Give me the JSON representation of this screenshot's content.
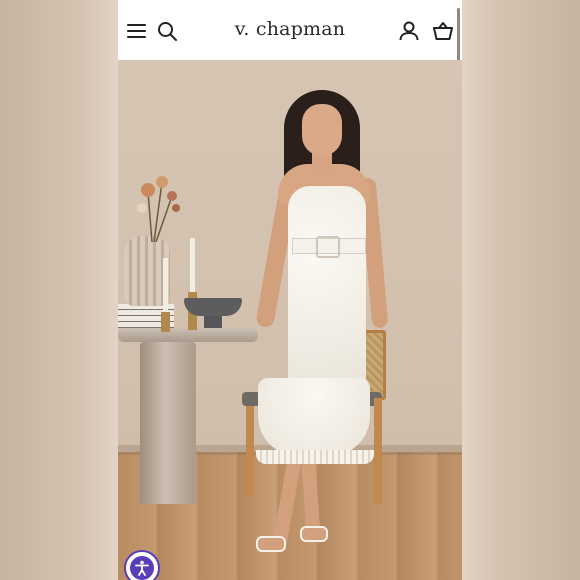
{
  "header": {
    "logo_text": "v. chapman",
    "menu_icon": "hamburger-icon",
    "search_icon": "search-icon",
    "account_icon": "user-icon",
    "cart_icon": "basket-icon"
  },
  "colors": {
    "header_bg": "#ffffff",
    "icon_color": "#222222",
    "accessibility_accent": "#5a3db8"
  },
  "accessibility_button": {
    "icon": "accessibility-icon"
  }
}
